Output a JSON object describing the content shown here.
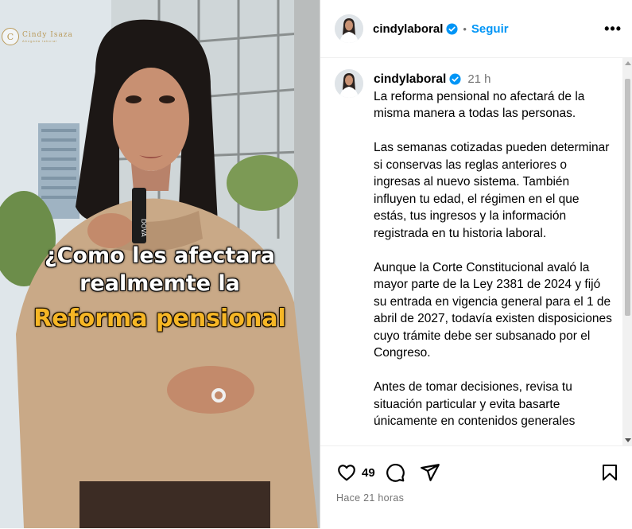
{
  "media": {
    "brand_mark": "C",
    "brand_name": "Cindy Isaza",
    "brand_sub": "Abogada laboral",
    "bottle_text": "DOVA",
    "overlay_line1": "¿Como les afectara",
    "overlay_line2": "realmemte la",
    "overlay_line3": "Reforma pensional"
  },
  "header": {
    "username": "cindylaboral",
    "separator": "•",
    "follow_label": "Seguir",
    "more_label": "•••"
  },
  "caption": {
    "username": "cindylaboral",
    "time": "21 h",
    "paragraphs": [
      "La reforma pensional no afectará de la misma manera a todas las personas.",
      "Las semanas cotizadas pueden determinar si conservas las reglas anteriores o ingresas al nuevo sistema. También influyen tu edad, el régimen en el que estás, tus ingresos y la información registrada en tu historia laboral.",
      "Aunque la Corte Constitucional avaló la mayor parte de la Ley 2381 de 2024 y fijó su entrada en vigencia general para el 1 de abril de 2027, todavía existen disposiciones cuyo trámite debe ser subsanado por el Congreso.",
      "Antes de tomar decisiones, revisa tu situación particular y evita basarte únicamente en contenidos generales"
    ]
  },
  "actions": {
    "likes_count": "49",
    "time_ago": "Hace 21 horas"
  },
  "icons": {
    "like": "heart-icon",
    "comment": "comment-icon",
    "share": "send-icon",
    "save": "bookmark-icon",
    "verified": "verified-badge-icon",
    "more": "more-options-icon"
  },
  "colors": {
    "follow": "#0095f6",
    "verified": "#0095f6",
    "overlay_highlight": "#f6b625",
    "muted": "#737373"
  }
}
